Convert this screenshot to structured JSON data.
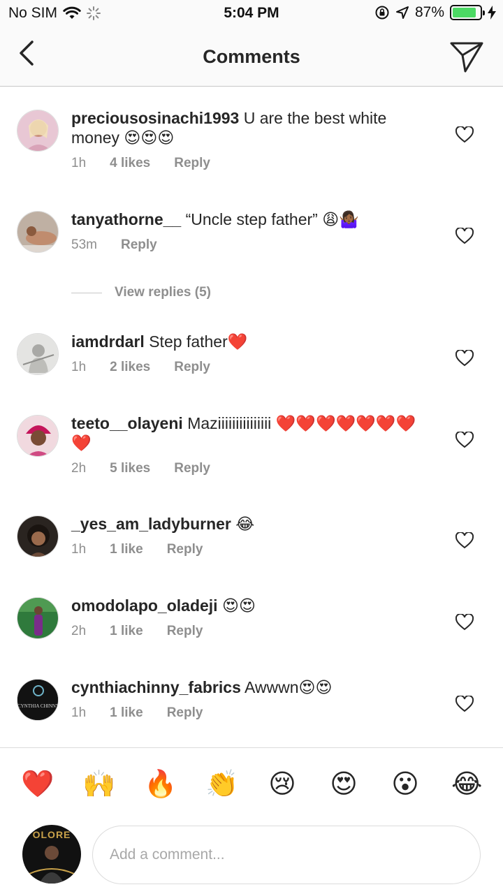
{
  "status_bar": {
    "carrier": "No SIM",
    "time": "5:04 PM",
    "battery": "87%",
    "battery_level": 0.87,
    "battery_color": "#4cd964"
  },
  "nav": {
    "title": "Comments",
    "back_icon": "chevron-left-icon",
    "share_icon": "paper-plane-icon"
  },
  "comments": [
    {
      "username": "preciousosinachi1993",
      "text": "U are the best white money 😍😍😍",
      "time": "1h",
      "likes": "4 likes",
      "reply": "Reply"
    },
    {
      "username": "tanyathorne__",
      "text": "“Uncle step father” 😩🤷🏾‍♀️",
      "time": "53m",
      "likes": "",
      "reply": "Reply"
    },
    {
      "username": "iamdrdarl",
      "text": "Step father❤️",
      "time": "1h",
      "likes": "2 likes",
      "reply": "Reply"
    },
    {
      "username": "teeto__olayeni",
      "text": "Maziiiiiiiiiiiiiii ❤️❤️❤️❤️❤️❤️❤️❤️",
      "time": "2h",
      "likes": "5 likes",
      "reply": "Reply"
    },
    {
      "username": "_yes_am_ladyburner",
      "text": "😂",
      "time": "1h",
      "likes": "1 like",
      "reply": "Reply"
    },
    {
      "username": "omodolapo_oladeji",
      "text": "😍😍",
      "time": "2h",
      "likes": "1 like",
      "reply": "Reply"
    },
    {
      "username": "cynthiachinny_fabrics",
      "text": "Awwwn😍😍",
      "time": "1h",
      "likes": "1 like",
      "reply": "Reply"
    }
  ],
  "view_replies": "View replies (5)",
  "cynthia_logo_text": "CYNTHIA CHINNY",
  "emoji_bar": [
    "❤️",
    "🙌",
    "🔥",
    "👏",
    "😢",
    "😍",
    "😮",
    "😂"
  ],
  "composer": {
    "placeholder": "Add a comment...",
    "avatar_text": "OLORE"
  },
  "colors": {
    "text": "#262626",
    "meta": "#8e8e8e",
    "divider": "#dbdbdb"
  }
}
